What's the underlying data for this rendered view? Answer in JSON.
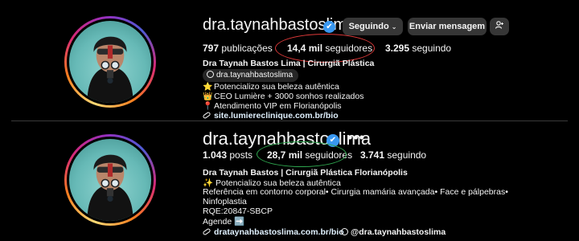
{
  "top": {
    "username": "dra.taynahbastoslima",
    "verified_badge": "✔",
    "following_button": "Seguindo",
    "message_button": "Enviar mensagem",
    "add_user_icon": "add-user-icon",
    "stats": {
      "posts_count": "797",
      "posts_label": "publicações",
      "followers_count": "14,4 mil",
      "followers_label": "seguidores",
      "following_count": "3.295",
      "following_label": "seguindo"
    },
    "display_name": "Dra Taynah Bastos Lima | Cirurgiã Plástica",
    "threads_handle": "dra.taynahbastoslima",
    "bio": [
      {
        "emoji": "⭐",
        "text": "Potencializo sua beleza autêntica"
      },
      {
        "emoji": "👑",
        "text": "CEO Lumière + 3000 sonhos realizados"
      },
      {
        "emoji": "📍",
        "text": "Atendimento VIP em Florianópolis"
      }
    ],
    "link": "site.lumiereclinique.com.br/bio",
    "highlight_color": "#e03a3a"
  },
  "bottom": {
    "username": "dra.taynahbastoslima",
    "verified_badge": "✔",
    "more_icon": "•••",
    "stats": {
      "posts_count": "1.043",
      "posts_label": "posts",
      "followers_count": "28,7 mil",
      "followers_label": "seguidores",
      "following_count": "3.741",
      "following_label": "seguindo"
    },
    "display_name": "Dra Taynah Bastos | Cirurgiã Plástica Florianópolis",
    "bio": [
      "✨ Potencializo sua beleza autêntica",
      "Referência em contorno corporal• Cirurgia mamária avançada• Face e pálpebras•",
      "Ninfoplastia",
      "RQE:20847-SBCP",
      "Agende ➡️"
    ],
    "link": "drataynahbastoslima.com.br/bio",
    "threads_handle": "@dra.taynahbastoslima",
    "highlight_color": "#2fa84f"
  }
}
